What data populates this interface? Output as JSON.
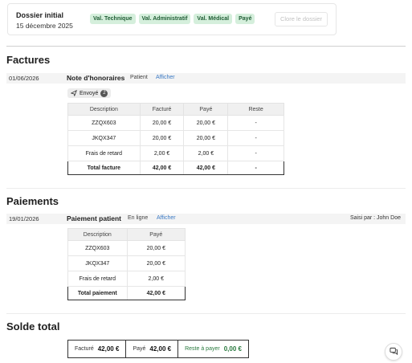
{
  "dossier": {
    "title": "Dossier initial",
    "date": "15 décembre 2025",
    "badges": [
      "Val. Technique",
      "Val. Administratif",
      "Val. Médical",
      "Payé"
    ],
    "close_label": "Clore le dossier"
  },
  "factures": {
    "title": "Factures",
    "row": {
      "date": "01/06/2026",
      "name": "Note d'honoraires",
      "tag": "Patient",
      "link": "Afficher"
    },
    "sent_label": "Envoyé",
    "sent_count": "2",
    "headers": [
      "Description",
      "Facturé",
      "Payé",
      "Reste"
    ],
    "rows": [
      [
        "ZZQX603",
        "20,00 €",
        "20,00 €",
        "-"
      ],
      [
        "JKQX347",
        "20,00 €",
        "20,00 €",
        "-"
      ],
      [
        "Frais de retard",
        "2,00 €",
        "2,00 €",
        "-"
      ]
    ],
    "total": [
      "Total facture",
      "42,00 €",
      "42,00 €",
      "-"
    ]
  },
  "paiements": {
    "title": "Paiements",
    "row": {
      "date": "19/01/2026",
      "name": "Paiement patient",
      "tag": "En ligne",
      "link": "Afficher",
      "saisi": "Saisi par : John Doe"
    },
    "headers": [
      "Description",
      "Payé"
    ],
    "rows": [
      [
        "ZZQX603",
        "20,00 €"
      ],
      [
        "JKQX347",
        "20,00 €"
      ],
      [
        "Frais de retard",
        "2,00 €"
      ]
    ],
    "total": [
      "Total paiement",
      "42,00 €"
    ]
  },
  "solde": {
    "title": "Solde total",
    "facture_label": "Facturé",
    "facture_value": "42,00 €",
    "paye_label": "Payé",
    "paye_value": "42,00 €",
    "reste_label": "Reste à payer",
    "reste_value": "0,00 €"
  },
  "icons": {
    "sent": "paper-plane-icon",
    "chat": "chat-icon"
  },
  "colors": {
    "badge_bg": "#d5efdc",
    "badge_text": "#1f5d34",
    "link": "#3a79c4",
    "reste_green": "#2a7a3f"
  }
}
